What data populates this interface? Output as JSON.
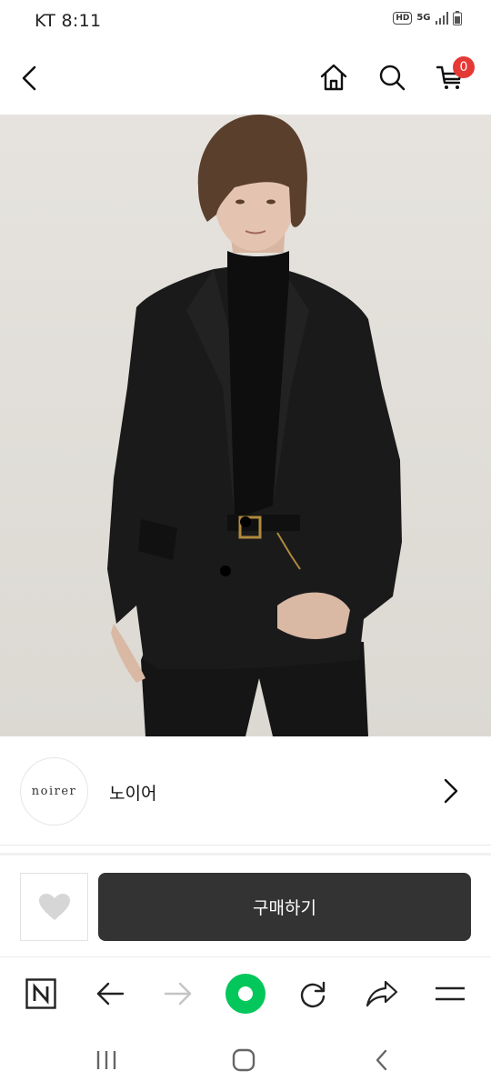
{
  "status_bar": {
    "text": "KT 8:11",
    "hd_label": "HD",
    "network_label": "5G"
  },
  "header": {
    "cart_count": "0",
    "icons": [
      "back-icon",
      "home-icon",
      "search-icon",
      "cart-icon"
    ]
  },
  "hero": {
    "description": "Model wearing a black oversized blazer over a black turtleneck with a gold-buckle belt"
  },
  "brand": {
    "logo_text": "noirer",
    "name": "노이어"
  },
  "actions": {
    "buy_label": "구매하기"
  },
  "browser_toolbar": {
    "icons": [
      "naver-icon",
      "back-arrow-icon",
      "forward-arrow-icon",
      "green-dot-icon",
      "refresh-icon",
      "share-icon",
      "menu-icon"
    ]
  },
  "android_nav": {
    "icons": [
      "recents-icon",
      "home-circle-icon",
      "back-chevron-icon"
    ]
  },
  "colors": {
    "badge": "#e53935",
    "buy_button": "#333333",
    "naver_green": "#03c75a"
  }
}
